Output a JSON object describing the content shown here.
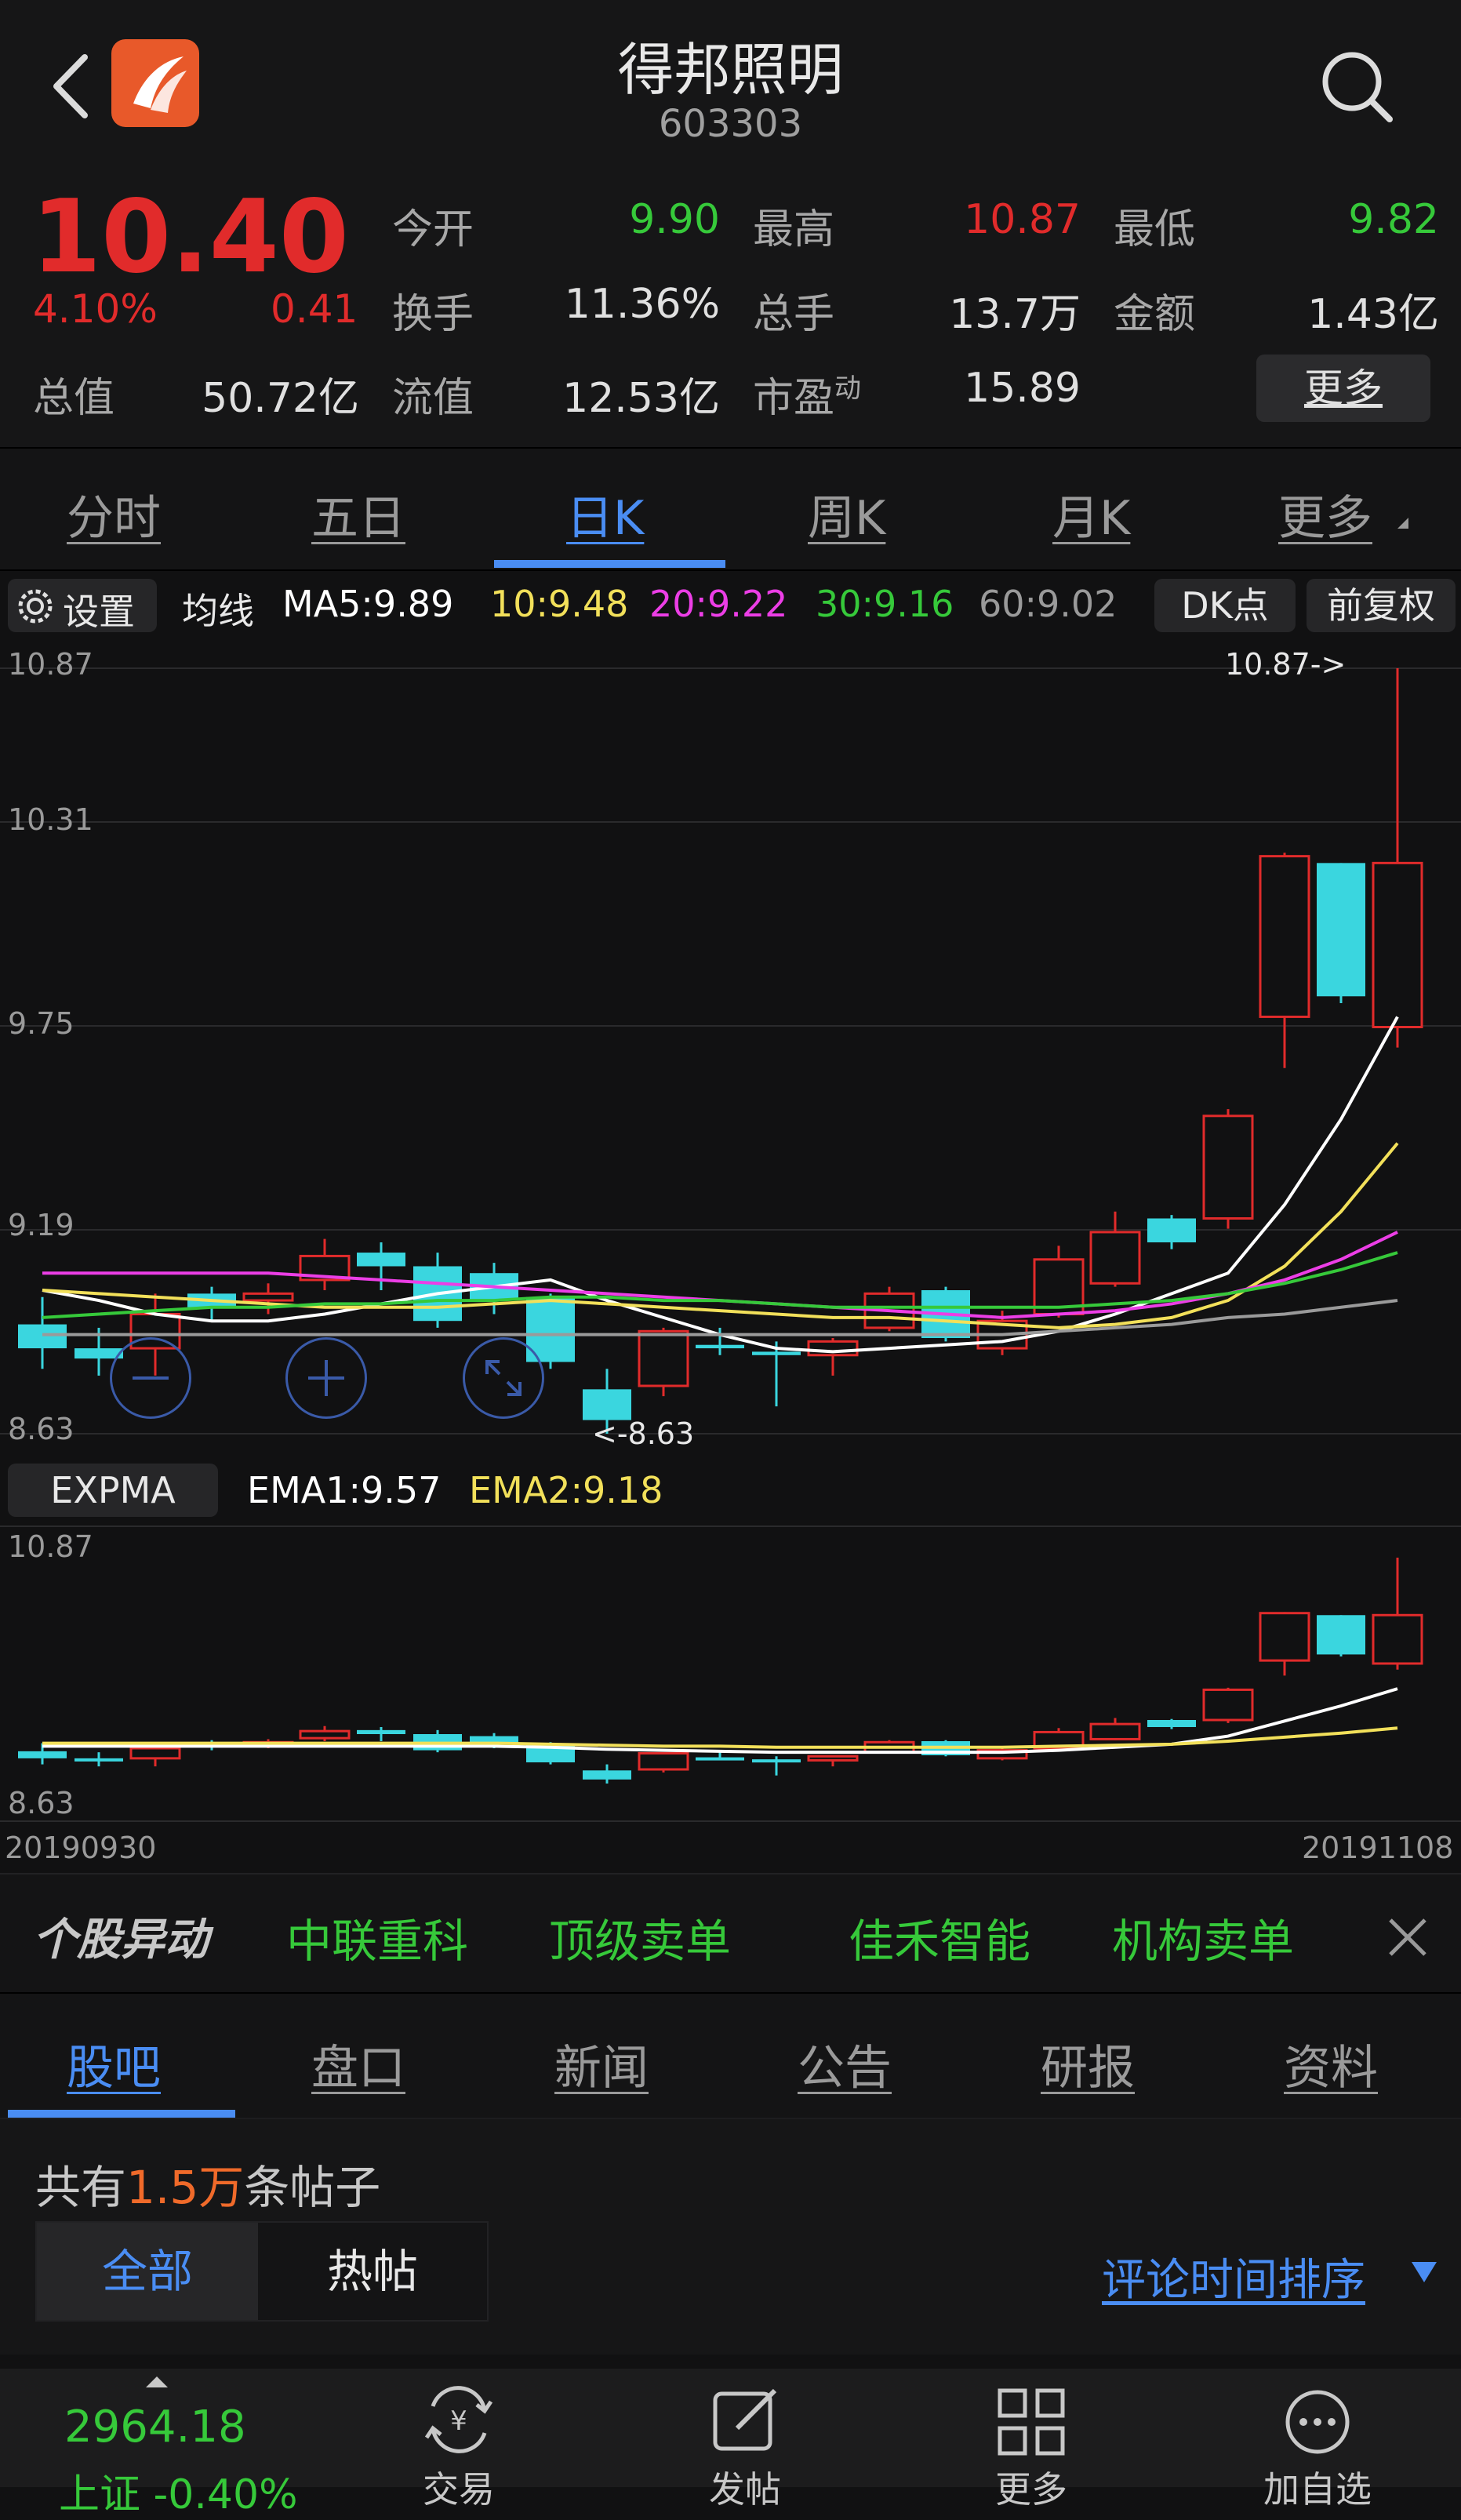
{
  "header": {
    "title": "得邦照明",
    "code": "603303"
  },
  "quote": {
    "price": "10.40",
    "change_pct": "4.10%",
    "change_amt": "0.41",
    "total_value_label": "总值",
    "total_value": "50.72亿",
    "float_value_label": "流值",
    "float_value": "12.53亿",
    "pe_label": "市盈",
    "pe_sup": "动",
    "pe": "15.89",
    "rows": [
      [
        {
          "label": "今开",
          "value": "9.90",
          "color": "green"
        },
        {
          "label": "最高",
          "value": "10.87",
          "color": "red"
        },
        {
          "label": "最低",
          "value": "9.82",
          "color": "green"
        }
      ],
      [
        {
          "label": "换手",
          "value": "11.36%",
          "color": "white"
        },
        {
          "label": "总手",
          "value": "13.7万",
          "color": "white"
        },
        {
          "label": "金额",
          "value": "1.43亿",
          "color": "white"
        }
      ]
    ],
    "more": "更多"
  },
  "period_tabs": [
    "分时",
    "五日",
    "日K",
    "周K",
    "月K",
    "更多"
  ],
  "ma_bar": {
    "settings": "设置",
    "ma_label": "均线",
    "ma5": "MA5:9.89",
    "ma10": "10:9.48",
    "ma20": "20:9.22",
    "ma30": "30:9.16",
    "ma60": "60:9.02",
    "dk": "DK点",
    "adjust": "前复权"
  },
  "main_chart": {
    "y_labels": [
      "10.87",
      "10.31",
      "9.75",
      "9.19",
      "8.63"
    ],
    "high_note": "10.87->",
    "low_note": "<-8.63"
  },
  "expma_bar": {
    "label": "EXPMA",
    "ema1": "EMA1:9.57",
    "ema2": "EMA2:9.18"
  },
  "sub_chart": {
    "y_top": "10.87",
    "y_bottom": "8.63",
    "date_start": "20190930",
    "date_end": "20191108"
  },
  "ticker": {
    "label": "个股异动",
    "items": [
      "中联重科",
      "顶级卖单",
      "佳禾智能",
      "机构卖单"
    ]
  },
  "section_tabs": [
    "股吧",
    "盘口",
    "新闻",
    "公告",
    "研报",
    "资料"
  ],
  "posts": {
    "prefix": "共有",
    "count": "1.5万",
    "suffix": "条帖子",
    "filter_all": "全部",
    "filter_hot": "热帖",
    "sort": "评论时间排序"
  },
  "bottom_bar": {
    "index_value": "2964.18",
    "index_sub": "上证 -0.40%",
    "items": [
      "交易",
      "发帖",
      "更多",
      "加自选"
    ]
  },
  "colors": {
    "up": "#e12b2b",
    "down": "#3ad6df",
    "accent": "#4a8df3",
    "green": "#36c93a",
    "yellow": "#f2e05a",
    "magenta": "#ec3ee6",
    "gray": "#9a9a9a"
  },
  "chart_data": [
    {
      "type": "candlestick",
      "title": "",
      "ylim": [
        8.63,
        10.87
      ],
      "y_ticks": [
        10.87,
        10.31,
        9.75,
        9.19,
        8.63
      ],
      "candles": [
        {
          "o": 8.95,
          "c": 8.88,
          "h": 9.03,
          "l": 8.82
        },
        {
          "o": 8.88,
          "c": 8.85,
          "h": 8.94,
          "l": 8.8
        },
        {
          "o": 8.88,
          "c": 8.98,
          "h": 9.04,
          "l": 8.8
        },
        {
          "o": 9.04,
          "c": 9.0,
          "h": 9.06,
          "l": 8.96
        },
        {
          "o": 9.02,
          "c": 9.04,
          "h": 9.07,
          "l": 8.98
        },
        {
          "o": 9.08,
          "c": 9.15,
          "h": 9.2,
          "l": 9.05
        },
        {
          "o": 9.16,
          "c": 9.12,
          "h": 9.19,
          "l": 9.05
        },
        {
          "o": 9.12,
          "c": 8.96,
          "h": 9.16,
          "l": 8.94
        },
        {
          "o": 9.1,
          "c": 9.02,
          "h": 9.13,
          "l": 8.98
        },
        {
          "o": 9.03,
          "c": 8.84,
          "h": 9.04,
          "l": 8.82
        },
        {
          "o": 8.76,
          "c": 8.67,
          "h": 8.82,
          "l": 8.63
        },
        {
          "o": 8.77,
          "c": 8.93,
          "h": 8.94,
          "l": 8.74
        },
        {
          "o": 8.89,
          "c": 8.88,
          "h": 8.94,
          "l": 8.86
        },
        {
          "o": 8.87,
          "c": 8.86,
          "h": 8.9,
          "l": 8.71
        },
        {
          "o": 8.86,
          "c": 8.9,
          "h": 8.91,
          "l": 8.8
        },
        {
          "o": 8.94,
          "c": 9.04,
          "h": 9.06,
          "l": 8.93
        },
        {
          "o": 9.05,
          "c": 8.91,
          "h": 9.06,
          "l": 8.9
        },
        {
          "o": 8.88,
          "c": 8.96,
          "h": 8.99,
          "l": 8.86
        },
        {
          "o": 8.98,
          "c": 9.14,
          "h": 9.18,
          "l": 8.97
        },
        {
          "o": 9.07,
          "c": 9.22,
          "h": 9.28,
          "l": 9.06
        },
        {
          "o": 9.26,
          "c": 9.19,
          "h": 9.27,
          "l": 9.17
        },
        {
          "o": 9.26,
          "c": 9.56,
          "h": 9.58,
          "l": 9.23
        },
        {
          "o": 9.85,
          "c": 10.32,
          "h": 10.33,
          "l": 9.7
        },
        {
          "o": 10.3,
          "c": 9.91,
          "h": 10.3,
          "l": 9.89
        },
        {
          "o": 9.82,
          "c": 10.3,
          "h": 10.87,
          "l": 9.76
        }
      ],
      "ma_series": [
        {
          "name": "MA5",
          "color": "#ffffff",
          "values": [
            9.05,
            9.02,
            8.98,
            8.96,
            8.96,
            8.98,
            9.01,
            9.04,
            9.06,
            9.08,
            9.02,
            8.97,
            8.92,
            8.88,
            8.87,
            8.88,
            8.89,
            8.9,
            8.93,
            8.98,
            9.04,
            9.1,
            9.3,
            9.55,
            9.85
          ]
        },
        {
          "name": "MA10",
          "color": "#f2e05a",
          "values": [
            9.05,
            9.04,
            9.03,
            9.02,
            9.01,
            9.0,
            9.0,
            9.0,
            9.01,
            9.02,
            9.01,
            9.0,
            8.99,
            8.98,
            8.97,
            8.97,
            8.96,
            8.95,
            8.94,
            8.95,
            8.97,
            9.02,
            9.12,
            9.28,
            9.48
          ]
        },
        {
          "name": "MA20",
          "color": "#ec3ee6",
          "values": [
            9.1,
            9.1,
            9.1,
            9.1,
            9.1,
            9.09,
            9.08,
            9.07,
            9.06,
            9.05,
            9.04,
            9.03,
            9.02,
            9.01,
            9.0,
            8.99,
            8.98,
            8.97,
            8.98,
            8.99,
            9.01,
            9.04,
            9.08,
            9.14,
            9.22
          ]
        },
        {
          "name": "MA30",
          "color": "#36c93a",
          "values": [
            8.97,
            8.98,
            8.99,
            9.0,
            9.0,
            9.01,
            9.01,
            9.02,
            9.02,
            9.03,
            9.03,
            9.02,
            9.02,
            9.01,
            9.0,
            9.0,
            9.0,
            9.0,
            9.0,
            9.01,
            9.02,
            9.04,
            9.07,
            9.11,
            9.16
          ]
        },
        {
          "name": "MA60",
          "color": "#9a9a9a",
          "values": [
            8.92,
            8.92,
            8.92,
            8.92,
            8.92,
            8.92,
            8.92,
            8.92,
            8.92,
            8.92,
            8.92,
            8.92,
            8.92,
            8.92,
            8.92,
            8.92,
            8.92,
            8.92,
            8.93,
            8.94,
            8.95,
            8.97,
            8.98,
            9.0,
            9.02
          ]
        }
      ]
    },
    {
      "type": "candlestick",
      "title": "",
      "ylim": [
        8.63,
        10.87
      ],
      "x_range": [
        "20190930",
        "20191108"
      ],
      "ema_series": [
        {
          "name": "EMA1",
          "color": "#ffffff",
          "values": [
            9.0,
            9.0,
            9.0,
            9.0,
            9.0,
            9.0,
            9.0,
            9.0,
            9.0,
            8.99,
            8.97,
            8.96,
            8.95,
            8.94,
            8.94,
            8.94,
            8.94,
            8.94,
            8.96,
            8.99,
            9.02,
            9.1,
            9.25,
            9.4,
            9.57
          ]
        },
        {
          "name": "EMA2",
          "color": "#f2e05a",
          "values": [
            9.03,
            9.03,
            9.03,
            9.03,
            9.03,
            9.03,
            9.03,
            9.03,
            9.03,
            9.02,
            9.01,
            9.0,
            9.0,
            8.99,
            8.99,
            8.99,
            8.99,
            8.99,
            9.0,
            9.01,
            9.02,
            9.05,
            9.09,
            9.13,
            9.18
          ]
        }
      ]
    }
  ]
}
